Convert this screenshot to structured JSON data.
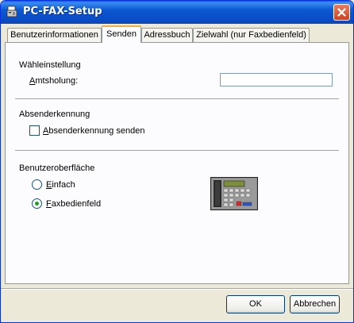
{
  "window": {
    "title": "PC-FAX-Setup"
  },
  "tabs": [
    {
      "label": "Benutzerinformationen",
      "active": false
    },
    {
      "label": "Senden",
      "active": true
    },
    {
      "label": "Adressbuch",
      "active": false
    },
    {
      "label": "Zielwahl (nur Faxbedienfeld)",
      "active": false
    }
  ],
  "dialing": {
    "section_title": "Wähleinstellung",
    "outside_line_label_first": "A",
    "outside_line_label_rest": "mtsholung:",
    "outside_line_value": ""
  },
  "sender_id": {
    "section_title": "Absenderkennung",
    "checkbox_label_first": "A",
    "checkbox_label_rest": "bsenderkennung senden",
    "checked": false
  },
  "ui_mode": {
    "section_title": "Benutzeroberfläche",
    "options": [
      {
        "label_first": "E",
        "label_rest": "infach",
        "selected": false
      },
      {
        "label_first": "F",
        "label_rest": "axbedienfeld",
        "selected": true
      }
    ]
  },
  "buttons": {
    "ok": "OK",
    "cancel": "Abbrechen"
  },
  "colors": {
    "titlebar": "#0a58d3",
    "dialog_bg": "#ece9d8",
    "active_tab_accent": "#f1b235",
    "radio_dot": "#21a121"
  },
  "icons": {
    "app": "fax-app-icon",
    "close": "close-icon",
    "preview": "fax-machine-icon"
  }
}
